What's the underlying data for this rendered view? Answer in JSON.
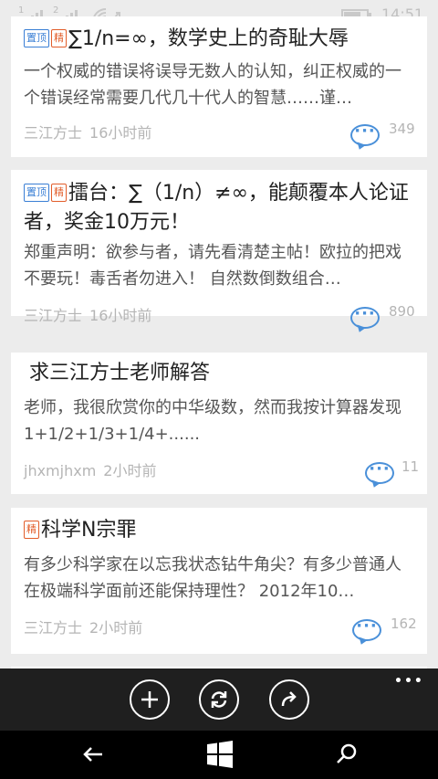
{
  "status_bar": {
    "sim1": "1",
    "sim2": "2",
    "time": "14:51",
    "icons": [
      "signal-icon",
      "signal-icon",
      "wifi-icon",
      "battery-icon"
    ]
  },
  "posts": [
    {
      "badges": [
        "置顶",
        "精"
      ],
      "title": "∑1/n=∞，数学史上的奇耻大辱",
      "excerpt": "一个权威的错误将误导无数人的认知，纠正权威的一个错误经常需要几代几十代人的智慧……谨…",
      "author": "三江方士",
      "time": "16小时前",
      "comments": "349"
    },
    {
      "badges": [
        "置顶",
        "精"
      ],
      "title": "擂台：∑（1/n）≠∞，能颠覆本人论证者，奖金10万元！",
      "excerpt": "郑重声明：欲参与者，请先看清楚主帖！欧拉的把戏不要玩！毒舌者勿进入！ 自然数倒数组合…",
      "author": "三江方士",
      "time": "16小时前",
      "comments": "890"
    },
    {
      "badges": [],
      "title": "求三江方士老师解答",
      "excerpt": "老师，我很欣赏你的中华级数，然而我按计算器发现1+1/2+1/3+1/4+......",
      "author": "jhxmjhxm",
      "time": "2小时前",
      "comments": "11"
    },
    {
      "badges": [
        "精"
      ],
      "title": "科学N宗罪",
      "excerpt": "有多少科学家在以忘我状态钻牛角尖？有多少普通人在极端科学面前还能保持理性？ 2012年10…",
      "author": "三江方士",
      "time": "2小时前",
      "comments": "162"
    }
  ],
  "app_bar": {
    "buttons": [
      "add-icon",
      "refresh-icon",
      "share-icon"
    ],
    "more": "•••"
  },
  "nav_bar": {
    "buttons": [
      "back-icon",
      "windows-icon",
      "search-icon"
    ]
  },
  "colors": {
    "badge_top": "#3a7fd5",
    "badge_best": "#e25d2a",
    "comment_icon": "#4a90d9"
  }
}
